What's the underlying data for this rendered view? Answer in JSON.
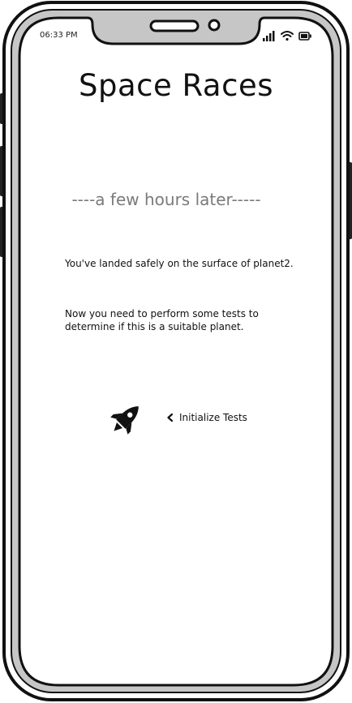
{
  "status_bar": {
    "time": "06:33 PM",
    "icons": [
      "signal-icon",
      "wifi-icon",
      "battery-icon"
    ]
  },
  "screen": {
    "title": "Space Races",
    "subtitle": "----a few hours later-----",
    "paragraph_1": "You've landed safely on the surface of planet2.",
    "paragraph_2": "Now you need to perform some tests to determine if this is a suitable planet.",
    "action_link": {
      "icon": "chevron-left-icon",
      "label": "Initialize Tests"
    },
    "illustration_icon": "rocket-icon"
  }
}
